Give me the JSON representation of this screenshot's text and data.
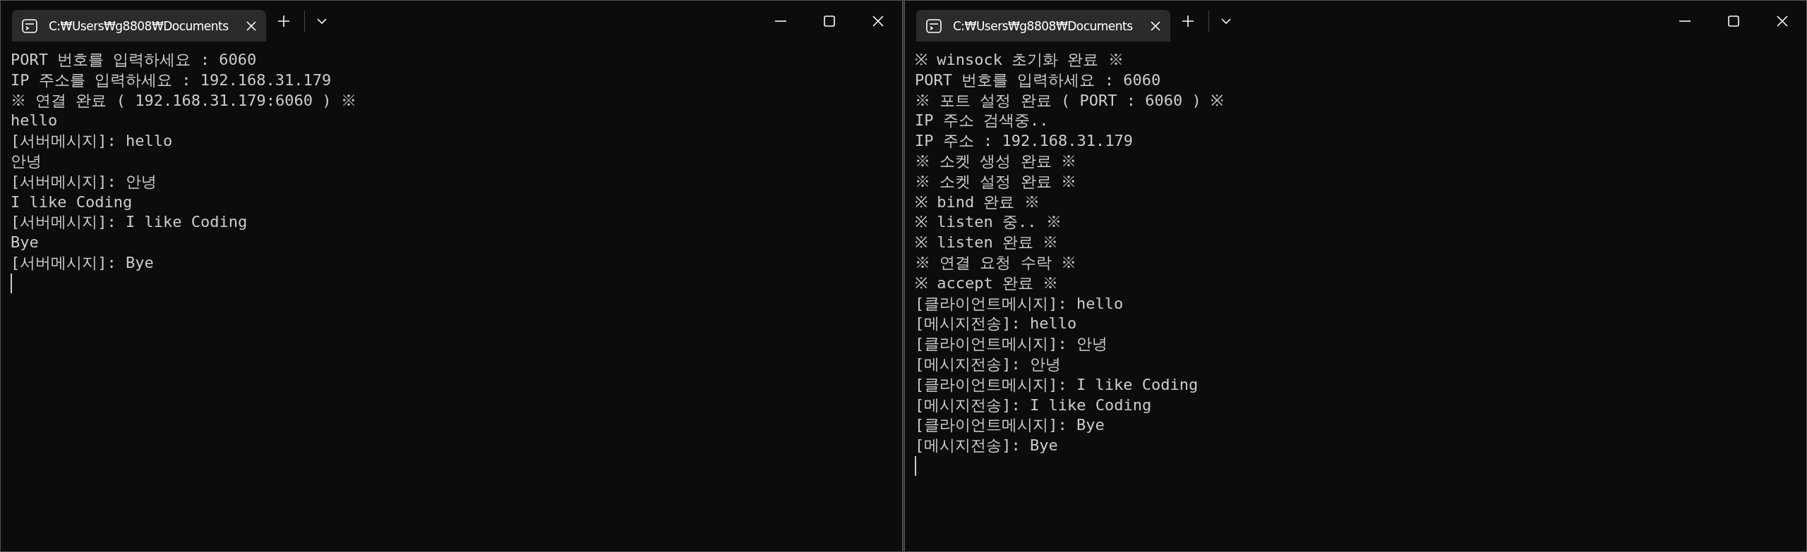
{
  "windows": [
    {
      "tab": {
        "title": "C:₩Users₩g8808₩Documents",
        "selected": true
      },
      "lines": [
        "PORT 번호를 입력하세요 : 6060",
        "IP 주소를 입력하세요 : 192.168.31.179",
        "※ 연결 완료 ( 192.168.31.179:6060 ) ※",
        "hello",
        "[서버메시지]: hello",
        "안녕",
        "[서버메시지]: 안녕",
        "I like Coding",
        "[서버메시지]: I like Coding",
        "Bye",
        "[서버메시지]: Bye"
      ],
      "cursor": true
    },
    {
      "tab": {
        "title": "C:₩Users₩g8808₩Documents",
        "selected": true
      },
      "lines": [
        "※ winsock 초기화 완료 ※",
        "PORT 번호를 입력하세요 : 6060",
        "※ 포트 설정 완료 ( PORT : 6060 ) ※",
        "IP 주소 검색중..",
        "IP 주소 : 192.168.31.179",
        "※ 소켓 생성 완료 ※",
        "※ 소켓 설정 완료 ※",
        "※ bind 완료 ※",
        "※ listen 중.. ※",
        "※ listen 완료 ※",
        "※ 연결 요청 수락 ※",
        "※ accept 완료 ※",
        "[클라이언트메시지]: hello",
        "[메시지전송]: hello",
        "[클라이언트메시지]: 안녕",
        "[메시지전송]: 안녕",
        "[클라이언트메시지]: I like Coding",
        "[메시지전송]: I like Coding",
        "[클라이언트메시지]: Bye",
        "[메시지전송]: Bye"
      ],
      "cursor": true
    }
  ]
}
